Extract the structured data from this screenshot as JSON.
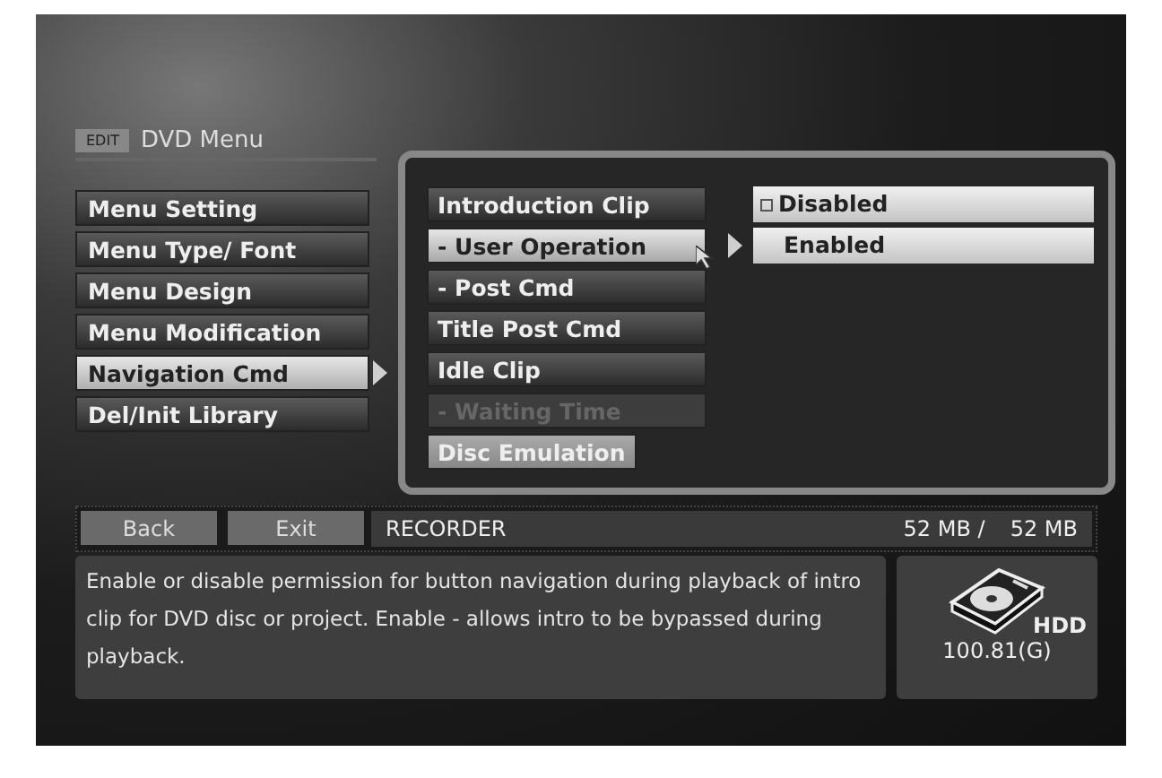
{
  "header": {
    "badge": "EDIT",
    "title": "DVD Menu"
  },
  "menu": [
    {
      "label": "Menu Setting",
      "selected": false
    },
    {
      "label": "Menu Type/ Font",
      "selected": false
    },
    {
      "label": "Menu Design",
      "selected": false
    },
    {
      "label": "Menu Modification",
      "selected": false
    },
    {
      "label": "Navigation Cmd",
      "selected": true
    },
    {
      "label": "Del/Init Library",
      "selected": false
    }
  ],
  "submenu": [
    {
      "label": "Introduction Clip",
      "kind": "row",
      "selected": false,
      "disabled": false
    },
    {
      "label": "- User Operation",
      "kind": "row",
      "selected": true,
      "disabled": false
    },
    {
      "label": "- Post Cmd",
      "kind": "row",
      "selected": false,
      "disabled": false
    },
    {
      "label": "Title Post Cmd",
      "kind": "row",
      "selected": false,
      "disabled": false
    },
    {
      "label": "Idle Clip",
      "kind": "row",
      "selected": false,
      "disabled": false
    },
    {
      "label": "- Waiting Time",
      "kind": "row",
      "selected": false,
      "disabled": true
    },
    {
      "label": "Disc Emulation",
      "kind": "chip",
      "selected": false,
      "disabled": false
    }
  ],
  "options": [
    {
      "label": "Disabled",
      "current": true
    },
    {
      "label": "Enabled",
      "current": false
    }
  ],
  "bottom_bar": {
    "buttons": [
      "Back",
      "Exit"
    ],
    "source": "RECORDER",
    "used": "52 MB /",
    "total": "52 MB"
  },
  "description": "Enable or disable permission for button navigation during playback of intro clip for DVD disc or project. Enable - allows intro to be bypassed during playback.",
  "drive": {
    "label": "HDD",
    "capacity": "100.81(G)"
  }
}
